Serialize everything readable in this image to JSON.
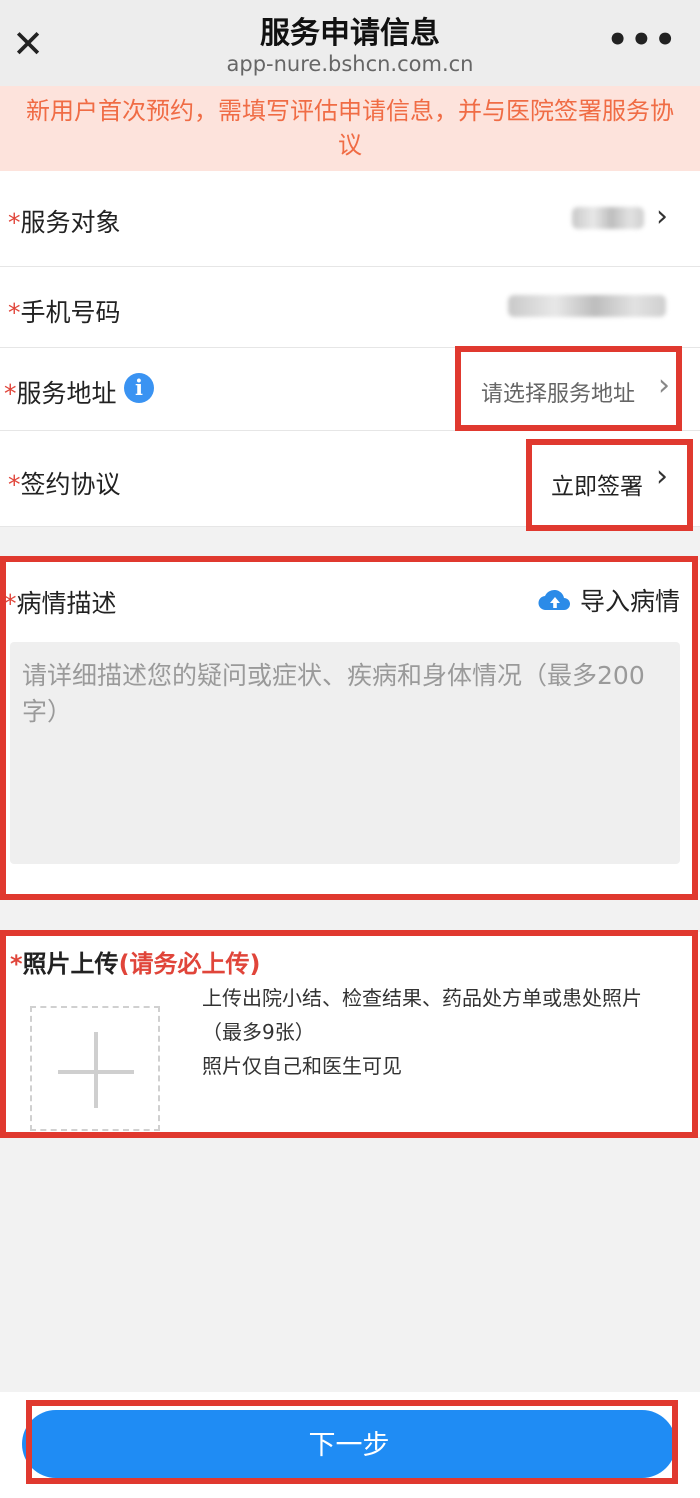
{
  "header": {
    "close_icon": "✕",
    "title": "服务申请信息",
    "url": "app-nure.bshcn.com.cn",
    "more_icon": "•••"
  },
  "notice": {
    "text": "新用户首次预约，需填写评估申请信息，并与医院签署服务协议"
  },
  "form": {
    "required_mark": "*",
    "service_target": {
      "label": "服务对象"
    },
    "phone": {
      "label": "手机号码"
    },
    "address": {
      "label": "服务地址",
      "placeholder": "请选择服务地址"
    },
    "agreement": {
      "label": "签约协议",
      "action": "立即签署"
    }
  },
  "description": {
    "label": "病情描述",
    "import_label": "导入病情",
    "placeholder": "请详细描述您的疑问或症状、疾病和身体情况（最多200字）"
  },
  "photo": {
    "label": "照片上传",
    "must_label": "(请务必上传)",
    "hint_line1": "上传出院小结、检查结果、药品处方单或患处照片",
    "hint_line2": "（最多9张）",
    "hint_line3": "照片仅自己和医生可见"
  },
  "footer": {
    "next_label": "下一步"
  },
  "colors": {
    "accent": "#1f8cf4",
    "notice_text": "#f06c45",
    "notice_bg": "#fde3dc",
    "required": "#e0453a",
    "highlight_box": "#e0392f"
  }
}
